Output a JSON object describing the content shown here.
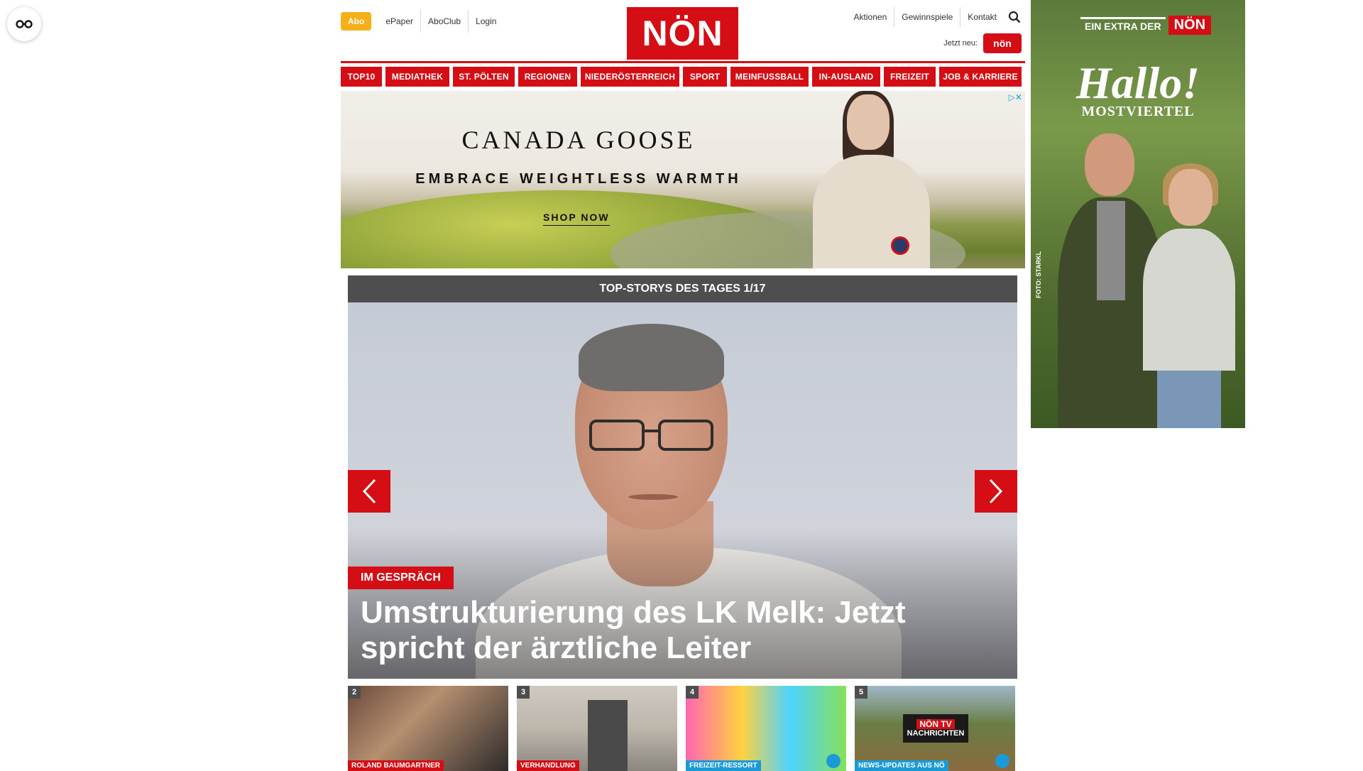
{
  "header": {
    "abo_label": "Abo",
    "left_links": [
      "ePaper",
      "AboClub",
      "Login"
    ],
    "logo_text": "NÖN",
    "right_links": [
      "Aktionen",
      "Gewinnspiele",
      "Kontakt"
    ],
    "jetzt_label": "Jetzt neu:",
    "jetzt_badge": "nön"
  },
  "nav": {
    "items": [
      {
        "label": "TOP10"
      },
      {
        "label": "MEDIATHEK"
      },
      {
        "label": "ST. PÖLTEN"
      },
      {
        "label": "REGIONEN"
      },
      {
        "label": "NIEDERÖSTERREICH"
      },
      {
        "label": "SPORT"
      },
      {
        "label": "MEINFUSSBALL"
      },
      {
        "label": "IN-AUSLAND"
      },
      {
        "label": "FREIZEIT"
      },
      {
        "label": "JOB & KARRIERE"
      }
    ]
  },
  "banner_ad": {
    "brand": "CANADA GOOSE",
    "claim": "EMBRACE WEIGHTLESS WARMTH",
    "cta": "SHOP NOW",
    "adchoice": "▷✕"
  },
  "top_story": {
    "header": "TOP-STORYS DES TAGES 1/17",
    "kicker": "IM GESPRÄCH",
    "headline": "Umstrukturierung des LK Melk: Jetzt spricht der ärztliche Leiter"
  },
  "thumbs": [
    {
      "num": "2",
      "label": "ROLAND BAUMGARTNER"
    },
    {
      "num": "3",
      "label": "VERHANDLUNG"
    },
    {
      "num": "4",
      "label": "FREIZEIT-RESSORT"
    },
    {
      "num": "5",
      "label": "NEWS-UPDATES AUS NÖ",
      "logo_top": "NÖN TV",
      "logo_bottom": "NACHRICHTEN"
    }
  ],
  "side_ad": {
    "extra": "EIN EXTRA DER",
    "logo": "NÖN",
    "hallo": "Hallo!",
    "sub": "MOSTVIERTEL",
    "credit": "FOTO: STARKL"
  },
  "colors": {
    "brand_red": "#d40e14",
    "abo_yellow": "#f5b019",
    "story_header_gray": "#4e4e4e"
  }
}
